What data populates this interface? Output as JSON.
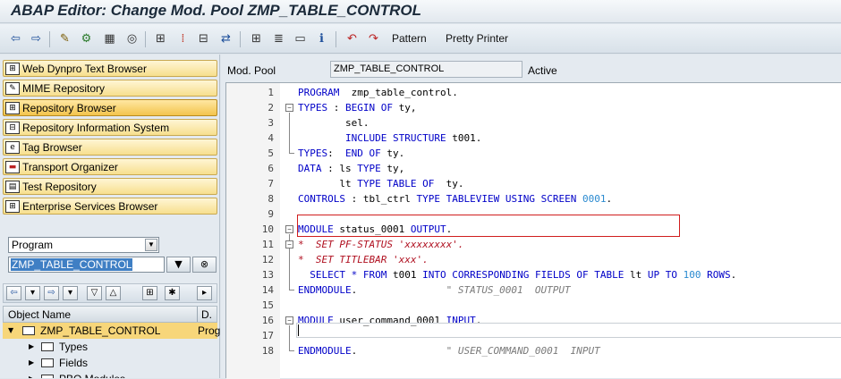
{
  "window": {
    "title": "ABAP Editor: Change Mod. Pool ZMP_TABLE_CONTROL"
  },
  "toolbar": {
    "icons": [
      "back-arrow-icon",
      "forward-arrow-icon",
      "display-change-icon",
      "active-inactive-icon",
      "object-list-icon",
      "where-used-icon",
      "hierarchy-icon",
      "breakpoint-icon",
      "display-object-icon",
      "navigation-icon",
      "layout-icon",
      "enhance-icon",
      "frame-icon",
      "info-icon",
      "undo-icon",
      "redo-icon"
    ],
    "pattern_label": "Pattern",
    "pretty_printer_label": "Pretty Printer"
  },
  "nav": {
    "items": [
      {
        "label": "Web Dynpro Text Browser",
        "icon": "hierarchy-icon",
        "active": false
      },
      {
        "label": "MIME Repository",
        "icon": "mime-icon",
        "active": false
      },
      {
        "label": "Repository Browser",
        "icon": "hierarchy-icon",
        "active": true
      },
      {
        "label": "Repository Information System",
        "icon": "info-system-icon",
        "active": false
      },
      {
        "label": "Tag Browser",
        "icon": "tag-icon",
        "active": false
      },
      {
        "label": "Transport Organizer",
        "icon": "truck-icon",
        "active": false
      },
      {
        "label": "Test Repository",
        "icon": "test-icon",
        "active": false
      },
      {
        "label": "Enterprise Services Browser",
        "icon": "services-icon",
        "active": false
      }
    ]
  },
  "object_select": {
    "type": "Program",
    "name": "ZMP_TABLE_CONTROL"
  },
  "tree": {
    "col_object": "Object Name",
    "col_desc": "D.",
    "rows": [
      {
        "label": "ZMP_TABLE_CONTROL",
        "desc": "Prog"
      },
      {
        "label": "Types"
      },
      {
        "label": "Fields"
      },
      {
        "label": "PBO Modules"
      }
    ]
  },
  "editor": {
    "type_label": "Mod. Pool",
    "program_name": "ZMP_TABLE_CONTROL",
    "status": "Active",
    "lines": [
      {
        "n": "1",
        "text": "PROGRAM  zmp_table_control."
      },
      {
        "n": "2",
        "text": "TYPES : BEGIN OF ty,"
      },
      {
        "n": "3",
        "text": "        sel."
      },
      {
        "n": "4",
        "text": "        INCLUDE STRUCTURE t001."
      },
      {
        "n": "5",
        "text": "TYPES:  END OF ty."
      },
      {
        "n": "6",
        "text": "DATA : ls TYPE ty,"
      },
      {
        "n": "7",
        "text": "       lt TYPE TABLE OF  ty."
      },
      {
        "n": "8",
        "text": "CONTROLS : tbl_ctrl TYPE TABLEVIEW USING SCREEN 0001."
      },
      {
        "n": "9",
        "text": ""
      },
      {
        "n": "10",
        "text": "MODULE status_0001 OUTPUT."
      },
      {
        "n": "11",
        "text": "*  SET PF-STATUS 'xxxxxxxx'."
      },
      {
        "n": "12",
        "text": "*  SET TITLEBAR 'xxx'."
      },
      {
        "n": "13",
        "text": "  SELECT * FROM t001 INTO CORRESPONDING FIELDS OF TABLE lt UP TO 100 ROWS."
      },
      {
        "n": "14",
        "text": "ENDMODULE.               \" STATUS_0001  OUTPUT"
      },
      {
        "n": "15",
        "text": ""
      },
      {
        "n": "16",
        "text": "MODULE user_command_0001 INPUT."
      },
      {
        "n": "17",
        "text": ""
      },
      {
        "n": "18",
        "text": "ENDMODULE.               \" USER_COMMAND_0001  INPUT"
      }
    ]
  }
}
